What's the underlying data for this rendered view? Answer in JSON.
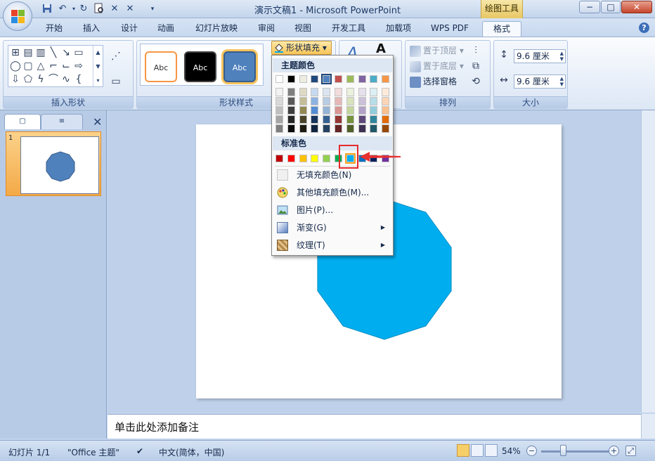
{
  "window": {
    "title": "演示文稿1 - Microsoft PowerPoint",
    "contextual_tab": "绘图工具",
    "min_label": "−",
    "restore_label": "□",
    "close_label": "✕"
  },
  "tabs": [
    {
      "label": "开始"
    },
    {
      "label": "插入"
    },
    {
      "label": "设计"
    },
    {
      "label": "动画"
    },
    {
      "label": "幻灯片放映"
    },
    {
      "label": "审阅"
    },
    {
      "label": "视图"
    },
    {
      "label": "开发工具"
    },
    {
      "label": "加载项"
    },
    {
      "label": "WPS PDF"
    },
    {
      "label": "格式",
      "active": true
    }
  ],
  "ribbon": {
    "insert_shapes_label": "插入形状",
    "shape_styles_label": "形状样式",
    "style_samples": [
      "Abc",
      "Abc",
      "Abc"
    ],
    "arrange_label": "排列",
    "size_label": "大小",
    "bring_front": "置于顶层",
    "send_back": "置于底层",
    "selection_pane": "选择窗格",
    "height_value": "9.6 厘米",
    "width_value": "9.6 厘米",
    "text_art_a1": "A",
    "text_art_a2": "A"
  },
  "fill_dropdown": {
    "button_label": "形状填充",
    "theme_colors_title": "主题颜色",
    "standard_colors_title": "标准色",
    "theme_top_row": [
      "#ffffff",
      "#000000",
      "#eeece1",
      "#1f497d",
      "#4f81bd",
      "#c0504d",
      "#9bbb59",
      "#8064a2",
      "#4bacc6",
      "#f79646"
    ],
    "theme_shades": [
      [
        "#f2f2f2",
        "#7f7f7f",
        "#ddd9c3",
        "#c6d9f0",
        "#dbe5f1",
        "#f2dcdb",
        "#ebf1dd",
        "#e5e0ec",
        "#dbeef3",
        "#fdeada"
      ],
      [
        "#d8d8d8",
        "#595959",
        "#c4bd97",
        "#8db3e2",
        "#b8cce4",
        "#e5b9b7",
        "#d7e3bc",
        "#ccc1d9",
        "#b7dde8",
        "#fbd5b5"
      ],
      [
        "#bfbfbf",
        "#3f3f3f",
        "#938953",
        "#548dd4",
        "#95b3d7",
        "#d99694",
        "#c3d69b",
        "#b2a2c7",
        "#92cddc",
        "#fac08f"
      ],
      [
        "#a5a5a5",
        "#262626",
        "#494429",
        "#17365d",
        "#366092",
        "#953734",
        "#76923c",
        "#5f497a",
        "#31859b",
        "#e36c09"
      ],
      [
        "#7f7f7f",
        "#0c0c0c",
        "#1d1b10",
        "#0f243e",
        "#244061",
        "#632423",
        "#4f6128",
        "#3f3151",
        "#205867",
        "#974806"
      ]
    ],
    "standard_colors": [
      "#c00000",
      "#ff0000",
      "#ffc000",
      "#ffff00",
      "#92d050",
      "#00b050",
      "#00b0f0",
      "#0070c0",
      "#002060",
      "#7030a0"
    ],
    "selected_standard_index": 6,
    "items": [
      {
        "label": "无填充颜色(N)",
        "icon": "no-fill-icon"
      },
      {
        "label": "其他填充颜色(M)...",
        "icon": "palette-icon"
      },
      {
        "label": "图片(P)...",
        "icon": "picture-icon"
      },
      {
        "label": "渐变(G)",
        "icon": "gradient-icon",
        "submenu": true
      },
      {
        "label": "纹理(T)",
        "icon": "texture-icon",
        "submenu": true
      }
    ]
  },
  "slides_pane": {
    "slide_number": "1"
  },
  "slide": {
    "shape_color": "#00aeef",
    "thumb_shape_color": "#4f81bd"
  },
  "notes": {
    "placeholder": "单击此处添加备注"
  },
  "status": {
    "slide_info": "幻灯片 1/1",
    "theme": "\"Office 主题\"",
    "language": "中文(简体，中国)",
    "zoom": "54%",
    "zoom_fraction": 0.54
  }
}
